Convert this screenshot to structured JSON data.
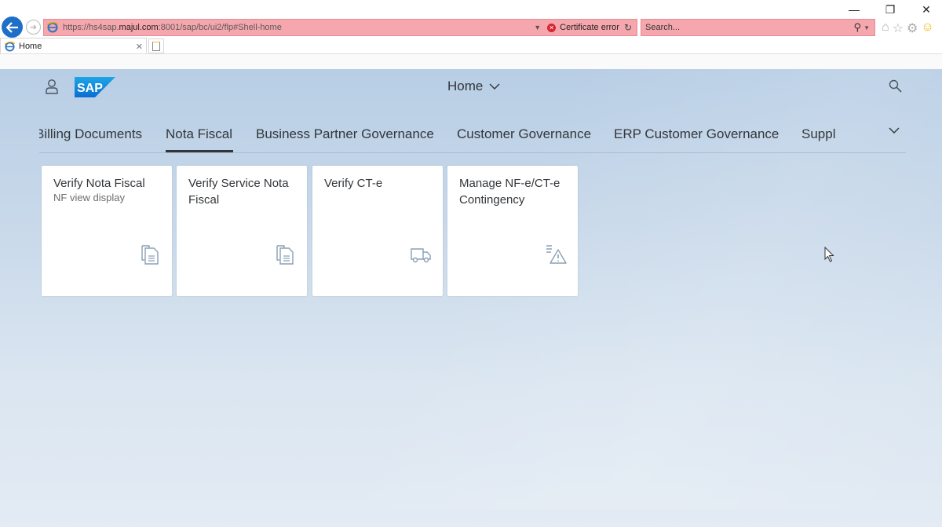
{
  "browser": {
    "url_prefix": "https://hs4sap.",
    "url_domain": "majul.com",
    "url_suffix": ":8001/sap/bc/ui2/flp#Shell-home",
    "certificate_text": "Certificate error",
    "search_placeholder": "Search...",
    "tab_title": "Home",
    "colors": {
      "address_error_bg": "#f6a7ad",
      "back_button": "#1f6fc9"
    }
  },
  "shell": {
    "title": "Home",
    "logo_text": "SAP"
  },
  "anchor_bar": {
    "items": [
      {
        "label": "Billing Documents",
        "selected": false
      },
      {
        "label": "Nota Fiscal",
        "selected": true
      },
      {
        "label": "Business Partner Governance",
        "selected": false
      },
      {
        "label": "Customer Governance",
        "selected": false
      },
      {
        "label": "ERP Customer Governance",
        "selected": false
      },
      {
        "label": "Suppl",
        "selected": false
      }
    ]
  },
  "tiles": [
    {
      "title": "Verify Nota Fiscal",
      "subtitle": "NF view display",
      "icon": "documents-icon"
    },
    {
      "title": "Verify Service Nota Fiscal",
      "subtitle": "",
      "icon": "documents-icon"
    },
    {
      "title": "Verify CT-e",
      "subtitle": "",
      "icon": "truck-icon"
    },
    {
      "title": "Manage NF-e/CT-e Contingency",
      "subtitle": "",
      "icon": "list-warning-icon"
    }
  ]
}
